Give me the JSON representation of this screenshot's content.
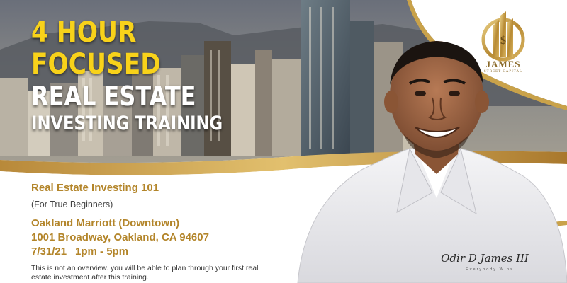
{
  "headline": {
    "line1": "4 HOUR",
    "line2": "FOCUSED",
    "line3": "REAL ESTATE",
    "line4": "INVESTING TRAINING"
  },
  "event": {
    "title": "Real Estate Investing 101",
    "subtitle": "(For True Beginners)",
    "venue": "Oakland Marriott (Downtown)",
    "address": "1001 Broadway, Oakland, CA 94607",
    "date": "7/31/21",
    "time": "1pm - 5pm",
    "description": "This is not an overview. you will be able to plan through your first real estate investment after this training."
  },
  "brand": {
    "logo_name": "JAMES",
    "logo_subtitle": "STREET CAPITAL",
    "signature": "Odir D James III",
    "tagline": "Everybody Wins"
  },
  "colors": {
    "headline_yellow": "#f8d21a",
    "gold_text": "#b3852a",
    "gold_accent": "#c9a24a",
    "body_text": "#333333"
  },
  "icons": [
    "james-street-capital-logo",
    "skyline-image",
    "presenter-photo",
    "gold-swoosh"
  ]
}
